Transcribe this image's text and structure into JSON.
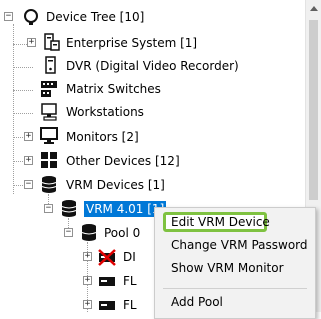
{
  "tree": {
    "root": {
      "label": "Device Tree [10]",
      "expander": "−"
    },
    "items": [
      {
        "label": "Enterprise System [1]",
        "expander": "+",
        "icon": "enterprise-server-icon"
      },
      {
        "label": "DVR (Digital Video Recorder)",
        "expander": "",
        "icon": "dvr-icon"
      },
      {
        "label": "Matrix Switches",
        "expander": "",
        "icon": "matrix-switch-icon"
      },
      {
        "label": "Workstations",
        "expander": "",
        "icon": "workstation-icon"
      },
      {
        "label": "Monitors [2]",
        "expander": "+",
        "icon": "monitor-icon"
      },
      {
        "label": "Other Devices [12]",
        "expander": "+",
        "icon": "other-devices-icon"
      },
      {
        "label": "VRM Devices [1]",
        "expander": "−",
        "icon": "vrm-devices-icon"
      }
    ],
    "vrm": {
      "label": "VRM 4.01 [1]",
      "expander": "−"
    },
    "pool": {
      "label": "Pool 0",
      "expander": "−"
    },
    "pool_children": [
      {
        "label": "DI",
        "expander": "+",
        "icon": "disconnected-iscsi-icon"
      },
      {
        "label": "FL",
        "expander": "+",
        "icon": "iscsi-device-icon"
      },
      {
        "label": "FL",
        "expander": "+",
        "icon": "iscsi-device-icon"
      }
    ]
  },
  "context_menu": {
    "items": [
      "Edit VRM Device",
      "Change VRM Password",
      "Show VRM Monitor",
      "Add Pool"
    ],
    "highlighted": "Edit VRM Device",
    "highlight_color": "#7fc241"
  },
  "colors": {
    "selection": "#0078d7"
  }
}
